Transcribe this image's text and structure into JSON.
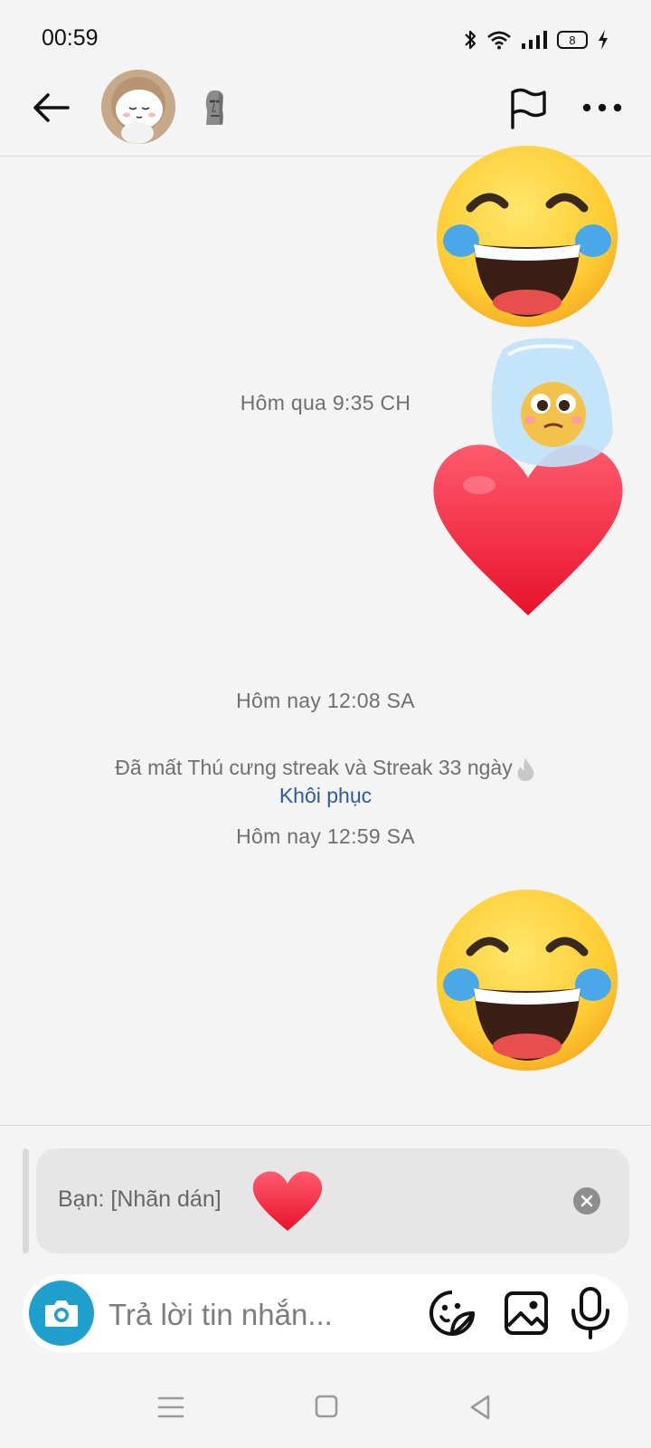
{
  "status_bar": {
    "time": "00:59",
    "battery_level": "8",
    "icons": [
      "bluetooth-icon",
      "wifi-icon",
      "signal-icon",
      "battery-icon",
      "charging-icon"
    ]
  },
  "header": {
    "icons": [
      "back-arrow-icon",
      "moai-emoji",
      "flag-icon",
      "more-icon"
    ]
  },
  "messages": [
    {
      "type": "sticker",
      "emoji": "face-with-tears-of-joy",
      "side": "right"
    },
    {
      "type": "timestamp",
      "text": "Hôm qua 9:35 CH"
    },
    {
      "type": "sticker",
      "emoji": "red-heart-with-frozen-face",
      "side": "right"
    },
    {
      "type": "timestamp",
      "text": "Hôm nay 12:08 SA"
    },
    {
      "type": "timestamp",
      "text": "Hôm nay 12:59 SA"
    },
    {
      "type": "sticker",
      "emoji": "face-with-tears-of-joy",
      "side": "right"
    }
  ],
  "streak_notice": {
    "text": "Đã mất Thú cưng streak và Streak 33 ngày",
    "action_label": "Khôi phục",
    "icon": "fire-icon"
  },
  "reply_preview": {
    "label": "Bạn: [Nhãn dán]",
    "sticker": "red-heart",
    "close_icon": "close-icon"
  },
  "composer": {
    "placeholder": "Trả lời tin nhắn...",
    "icons": [
      "camera-icon",
      "sticker-icon",
      "gallery-icon",
      "mic-icon"
    ],
    "accent_color": "#1fa0cc"
  },
  "nav_bar": {
    "icons": [
      "menu-icon",
      "home-icon",
      "back-icon"
    ]
  },
  "colors": {
    "background": "#f4f4f4",
    "link": "#2c5aa0",
    "muted_text": "#6f6f6f"
  }
}
